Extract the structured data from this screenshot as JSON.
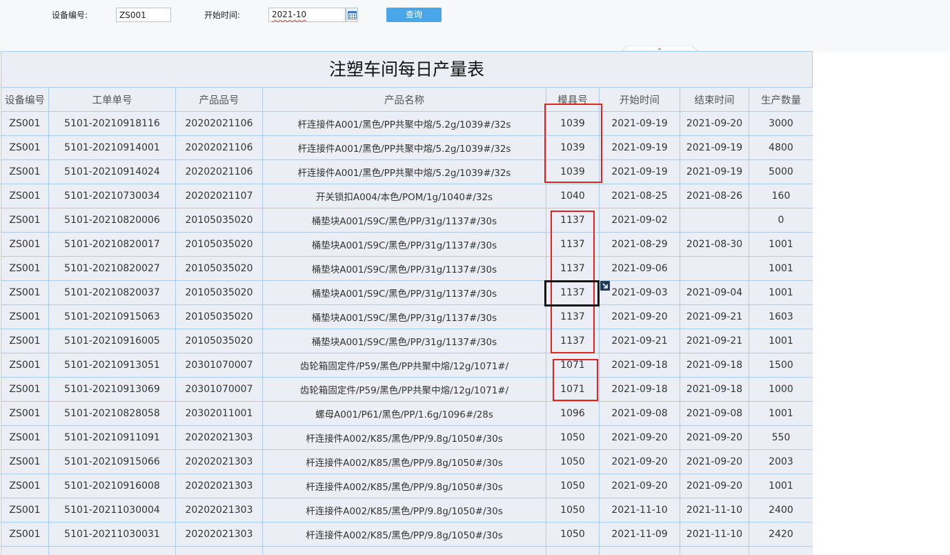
{
  "filters": {
    "device_label": "设备编号:",
    "device_value": "ZS001",
    "start_label": "开始时间:",
    "start_value": "2021-10",
    "query_label": "查询"
  },
  "report": {
    "title": "注塑车间每日产量表",
    "columns": [
      "设备编号",
      "工单单号",
      "产品品号",
      "产品名称",
      "模具号",
      "开始时间",
      "结束时间",
      "生产数量"
    ],
    "rows": [
      [
        "ZS001",
        "5101-20210918116",
        "20202021106",
        "杆连接件A001/黑色/PP共聚中熔/5.2g/1039#/32s",
        "1039",
        "2021-09-19",
        "2021-09-20",
        "3000"
      ],
      [
        "ZS001",
        "5101-20210914001",
        "20202021106",
        "杆连接件A001/黑色/PP共聚中熔/5.2g/1039#/32s",
        "1039",
        "2021-09-19",
        "2021-09-19",
        "4800"
      ],
      [
        "ZS001",
        "5101-20210914024",
        "20202021106",
        "杆连接件A001/黑色/PP共聚中熔/5.2g/1039#/32s",
        "1039",
        "2021-09-19",
        "2021-09-19",
        "5000"
      ],
      [
        "ZS001",
        "5101-20210730034",
        "20202021107",
        "开关锁扣A004/本色/POM/1g/1040#/32s",
        "1040",
        "2021-08-25",
        "2021-08-26",
        "160"
      ],
      [
        "ZS001",
        "5101-20210820006",
        "20105035020",
        "桶垫块A001/S9C/黑色/PP/31g/1137#/30s",
        "1137",
        "2021-09-02",
        "",
        "0"
      ],
      [
        "ZS001",
        "5101-20210820017",
        "20105035020",
        "桶垫块A001/S9C/黑色/PP/31g/1137#/30s",
        "1137",
        "2021-08-29",
        "2021-08-30",
        "1001"
      ],
      [
        "ZS001",
        "5101-20210820027",
        "20105035020",
        "桶垫块A001/S9C/黑色/PP/31g/1137#/30s",
        "1137",
        "2021-09-06",
        "",
        "1001"
      ],
      [
        "ZS001",
        "5101-20210820037",
        "20105035020",
        "桶垫块A001/S9C/黑色/PP/31g/1137#/30s",
        "1137",
        "2021-09-03",
        "2021-09-04",
        "1001"
      ],
      [
        "ZS001",
        "5101-20210915063",
        "20105035020",
        "桶垫块A001/S9C/黑色/PP/31g/1137#/30s",
        "1137",
        "2021-09-20",
        "2021-09-21",
        "1603"
      ],
      [
        "ZS001",
        "5101-20210916005",
        "20105035020",
        "桶垫块A001/S9C/黑色/PP/31g/1137#/30s",
        "1137",
        "2021-09-21",
        "2021-09-21",
        "1001"
      ],
      [
        "ZS001",
        "5101-20210913051",
        "20301070007",
        "齿轮箱固定件/P59/黑色/PP共聚中熔/12g/1071#/",
        "1071",
        "2021-09-18",
        "2021-09-18",
        "1500"
      ],
      [
        "ZS001",
        "5101-20210913069",
        "20301070007",
        "齿轮箱固定件/P59/黑色/PP共聚中熔/12g/1071#/",
        "1071",
        "2021-09-18",
        "2021-09-18",
        "1000"
      ],
      [
        "ZS001",
        "5101-20210828058",
        "20302011001",
        "螺母A001/P61/黑色/PP/1.6g/1096#/28s",
        "1096",
        "2021-09-08",
        "2021-09-08",
        "1001"
      ],
      [
        "ZS001",
        "5101-20210911091",
        "20202021303",
        "杆连接件A002/K85/黑色/PP/9.8g/1050#/30s",
        "1050",
        "2021-09-20",
        "2021-09-20",
        "550"
      ],
      [
        "ZS001",
        "5101-20210915066",
        "20202021303",
        "杆连接件A002/K85/黑色/PP/9.8g/1050#/30s",
        "1050",
        "2021-09-20",
        "2021-09-20",
        "2003"
      ],
      [
        "ZS001",
        "5101-20210916008",
        "20202021303",
        "杆连接件A002/K85/黑色/PP/9.8g/1050#/30s",
        "1050",
        "2021-09-20",
        "2021-09-20",
        "1001"
      ],
      [
        "ZS001",
        "5101-20211030004",
        "20202021303",
        "杆连接件A002/K85/黑色/PP/9.8g/1050#/30s",
        "1050",
        "2021-11-10",
        "2021-11-10",
        "2400"
      ],
      [
        "ZS001",
        "5101-20211030031",
        "20202021303",
        "杆连接件A002/K85/黑色/PP/9.8g/1050#/30s",
        "1050",
        "2021-11-09",
        "2021-11-10",
        "2420"
      ],
      [
        "",
        "",
        "",
        "",
        "",
        "",
        "",
        ""
      ]
    ]
  },
  "icons": {
    "calendar": "calendar-icon",
    "expand": "expand-arrow-icon"
  },
  "colors": {
    "query_button": "#49a6e8",
    "annotation_red": "#e0241b",
    "grid_line": "#a9cbe8",
    "table_bg": "#ebeef4"
  }
}
